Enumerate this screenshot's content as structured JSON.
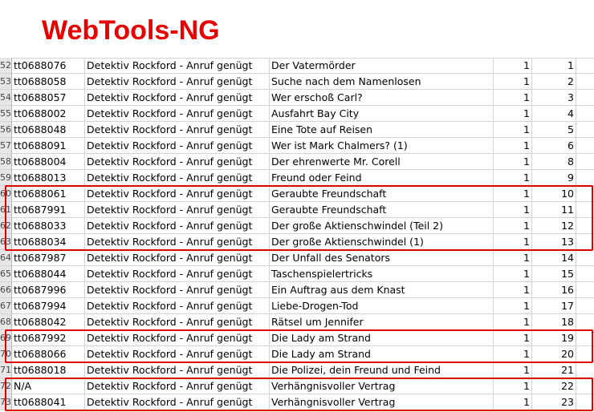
{
  "logo": {
    "text": "WebTools-NG",
    "color": "#e60000"
  },
  "highlight_color": "#e00000",
  "rows": [
    {
      "row_num": "52",
      "id": "tt0688076",
      "series": "Detektiv Rockford - Anruf genügt",
      "title": "Der Vatermörder",
      "season": "1",
      "episode": "1"
    },
    {
      "row_num": "53",
      "id": "tt0688058",
      "series": "Detektiv Rockford - Anruf genügt",
      "title": "Suche nach dem Namenlosen",
      "season": "1",
      "episode": "2"
    },
    {
      "row_num": "54",
      "id": "tt0688057",
      "series": "Detektiv Rockford - Anruf genügt",
      "title": "Wer erschoß Carl?",
      "season": "1",
      "episode": "3"
    },
    {
      "row_num": "55",
      "id": "tt0688002",
      "series": "Detektiv Rockford - Anruf genügt",
      "title": "Ausfahrt Bay City",
      "season": "1",
      "episode": "4"
    },
    {
      "row_num": "56",
      "id": "tt0688048",
      "series": "Detektiv Rockford - Anruf genügt",
      "title": "Eine Tote auf Reisen",
      "season": "1",
      "episode": "5"
    },
    {
      "row_num": "57",
      "id": "tt0688091",
      "series": "Detektiv Rockford - Anruf genügt",
      "title": "Wer ist Mark Chalmers? (1)",
      "season": "1",
      "episode": "6"
    },
    {
      "row_num": "58",
      "id": "tt0688004",
      "series": "Detektiv Rockford - Anruf genügt",
      "title": "Der ehrenwerte Mr. Corell",
      "season": "1",
      "episode": "8"
    },
    {
      "row_num": "59",
      "id": "tt0688013",
      "series": "Detektiv Rockford - Anruf genügt",
      "title": "Freund oder Feind",
      "season": "1",
      "episode": "9"
    },
    {
      "row_num": "60",
      "id": "tt0688061",
      "series": "Detektiv Rockford - Anruf genügt",
      "title": "Geraubte Freundschaft",
      "season": "1",
      "episode": "10"
    },
    {
      "row_num": "61",
      "id": "tt0687991",
      "series": "Detektiv Rockford - Anruf genügt",
      "title": "Geraubte Freundschaft",
      "season": "1",
      "episode": "11"
    },
    {
      "row_num": "62",
      "id": "tt0688033",
      "series": "Detektiv Rockford - Anruf genügt",
      "title": "Der große Aktienschwindel (Teil 2)",
      "season": "1",
      "episode": "12"
    },
    {
      "row_num": "63",
      "id": "tt0688034",
      "series": "Detektiv Rockford - Anruf genügt",
      "title": "Der große Aktienschwindel (1)",
      "season": "1",
      "episode": "13"
    },
    {
      "row_num": "64",
      "id": "tt0687987",
      "series": "Detektiv Rockford - Anruf genügt",
      "title": "Der Unfall des Senators",
      "season": "1",
      "episode": "14"
    },
    {
      "row_num": "65",
      "id": "tt0688044",
      "series": "Detektiv Rockford - Anruf genügt",
      "title": "Taschenspielertricks",
      "season": "1",
      "episode": "15"
    },
    {
      "row_num": "66",
      "id": "tt0687996",
      "series": "Detektiv Rockford - Anruf genügt",
      "title": "Ein Auftrag aus dem Knast",
      "season": "1",
      "episode": "16"
    },
    {
      "row_num": "67",
      "id": "tt0687994",
      "series": "Detektiv Rockford - Anruf genügt",
      "title": "Liebe-Drogen-Tod",
      "season": "1",
      "episode": "17"
    },
    {
      "row_num": "68",
      "id": "tt0688042",
      "series": "Detektiv Rockford - Anruf genügt",
      "title": "Rätsel um Jennifer",
      "season": "1",
      "episode": "18"
    },
    {
      "row_num": "69",
      "id": "tt0687992",
      "series": "Detektiv Rockford - Anruf genügt",
      "title": "Die Lady am Strand",
      "season": "1",
      "episode": "19"
    },
    {
      "row_num": "70",
      "id": "tt0688066",
      "series": "Detektiv Rockford - Anruf genügt",
      "title": "Die Lady am Strand",
      "season": "1",
      "episode": "20"
    },
    {
      "row_num": "71",
      "id": "tt0688018",
      "series": "Detektiv Rockford - Anruf genügt",
      "title": "Die Polizei, dein Freund und Feind",
      "season": "1",
      "episode": "21"
    },
    {
      "row_num": "72",
      "id": "N/A",
      "series": "Detektiv Rockford - Anruf genügt",
      "title": "Verhängnisvoller Vertrag",
      "season": "1",
      "episode": "22"
    },
    {
      "row_num": "73",
      "id": "tt0688041",
      "series": "Detektiv Rockford - Anruf genügt",
      "title": "Verhängnisvoller Vertrag",
      "season": "1",
      "episode": "23"
    }
  ]
}
